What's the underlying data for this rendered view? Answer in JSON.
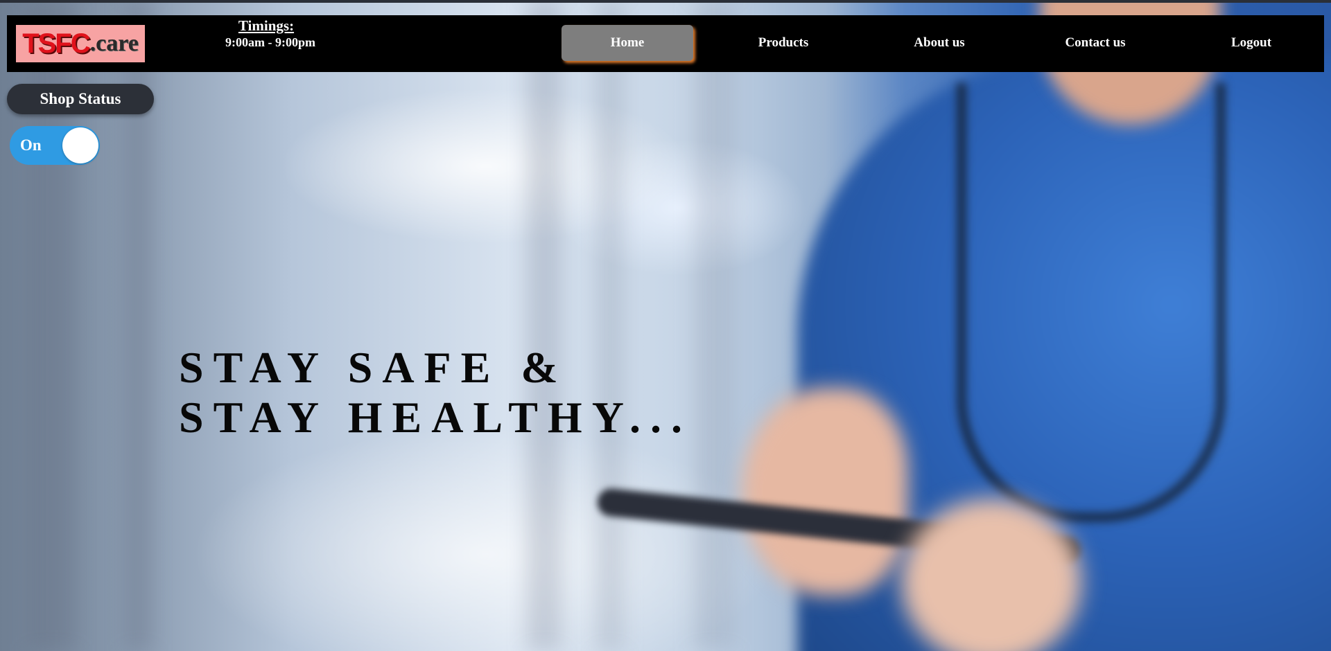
{
  "logo": {
    "brand": "TSFC",
    "tld": ".care"
  },
  "timings": {
    "title": "Timings:",
    "hours": "9:00am - 9:00pm"
  },
  "nav": {
    "items": [
      {
        "label": "Home",
        "active": true
      },
      {
        "label": "Products",
        "active": false
      },
      {
        "label": "About us",
        "active": false
      },
      {
        "label": "Contact us",
        "active": false
      },
      {
        "label": "Logout",
        "active": false
      }
    ]
  },
  "shop_status": {
    "title": "Shop Status",
    "toggle_label": "On",
    "toggle_on": true
  },
  "hero": {
    "line1": "STAY SAFE &",
    "line2": "STAY HEALTHY..."
  },
  "colors": {
    "navbar_bg": "#000000",
    "active_tab_bg": "#7e7e7e",
    "active_tab_shadow": "#e07a2a",
    "toggle_on": "#2f9be3",
    "logo_bg": "#f7a3a3",
    "logo_brand": "#e0121b"
  }
}
